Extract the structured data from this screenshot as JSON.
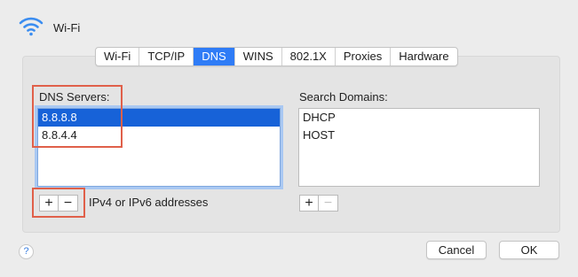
{
  "window": {
    "title": "Wi-Fi"
  },
  "tabs": [
    {
      "label": "Wi-Fi"
    },
    {
      "label": "TCP/IP"
    },
    {
      "label": "DNS"
    },
    {
      "label": "WINS"
    },
    {
      "label": "802.1X"
    },
    {
      "label": "Proxies"
    },
    {
      "label": "Hardware"
    }
  ],
  "active_tab": "DNS",
  "dns": {
    "label": "DNS Servers:",
    "servers": [
      "8.8.8.8",
      "8.8.4.4"
    ],
    "selected_index": 0,
    "add_label": "+",
    "remove_label": "−",
    "hint": "IPv4 or IPv6 addresses"
  },
  "search": {
    "label": "Search Domains:",
    "domains": [
      "DHCP",
      "HOST"
    ],
    "add_label": "+",
    "remove_label": "−"
  },
  "footer": {
    "help_label": "?",
    "cancel_label": "Cancel",
    "ok_label": "OK"
  },
  "colors": {
    "accent": "#2f7cf6",
    "selection": "#1762d8",
    "highlight_box": "#e0604a"
  },
  "icons": {
    "wifi": "wifi-icon"
  }
}
